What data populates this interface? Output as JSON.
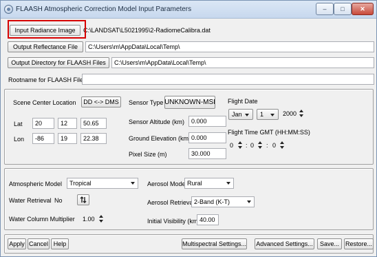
{
  "window": {
    "title": "FLAASH Atmospheric Correction Model Input Parameters",
    "min_glyph": "–",
    "max_glyph": "□",
    "close_glyph": "✕"
  },
  "files": {
    "input_radiance_label": "Input Radiance Image",
    "input_radiance_path": "C:\\LANDSAT\\L5021995\\2-RadiomeCalibra.dat",
    "output_reflectance_label": "Output Reflectance File",
    "output_reflectance_path": "C:\\Users\\m\\AppData\\Local\\Temp\\",
    "output_dir_label": "Output Directory for FLAASH Files",
    "output_dir_path": "C:\\Users\\m\\AppData\\Local\\Temp\\",
    "rootname_label": "Rootname for FLAASH Files",
    "rootname_value": ""
  },
  "scene": {
    "center_label": "Scene Center Location",
    "toggle_label": "DD <-> DMS",
    "lat_label": "Lat",
    "lat_deg": "20",
    "lat_min": "12",
    "lat_sec": "50.65",
    "lon_label": "Lon",
    "lon_deg": "-86",
    "lon_min": "19",
    "lon_sec": "22.38"
  },
  "sensor": {
    "type_label": "Sensor Type",
    "type_value": "UNKNOWN-MSI",
    "altitude_label": "Sensor Altitude (km)",
    "altitude_value": "0.000",
    "ground_label": "Ground Elevation (km)",
    "ground_value": "0.000",
    "pixel_label": "Pixel Size (m)",
    "pixel_value": "30.000"
  },
  "flight": {
    "date_label": "Flight Date",
    "month": "Jan",
    "day": "1",
    "year": "2000",
    "time_label": "Flight Time GMT (HH:MM:SS)",
    "hh": "0",
    "mm": "0",
    "ss": "0",
    "sep": ":"
  },
  "atmosphere": {
    "model_label": "Atmospheric Model",
    "model_value": "Tropical",
    "aerosol_model_label": "Aerosol Model",
    "aerosol_model_value": "Rural",
    "water_retrieval_label": "Water Retrieval",
    "water_retrieval_value": "No",
    "aerosol_retrieval_label": "Aerosol Retrieval",
    "aerosol_retrieval_value": "2-Band (K-T)",
    "water_column_label": "Water Column Multiplier",
    "water_column_value": "1.00",
    "visibility_label": "Initial Visibility (km)",
    "visibility_value": "40.00"
  },
  "footer": {
    "apply": "Apply",
    "cancel": "Cancel",
    "help": "Help",
    "multispectral": "Multispectral Settings...",
    "advanced": "Advanced Settings...",
    "save": "Save...",
    "restore": "Restore..."
  }
}
